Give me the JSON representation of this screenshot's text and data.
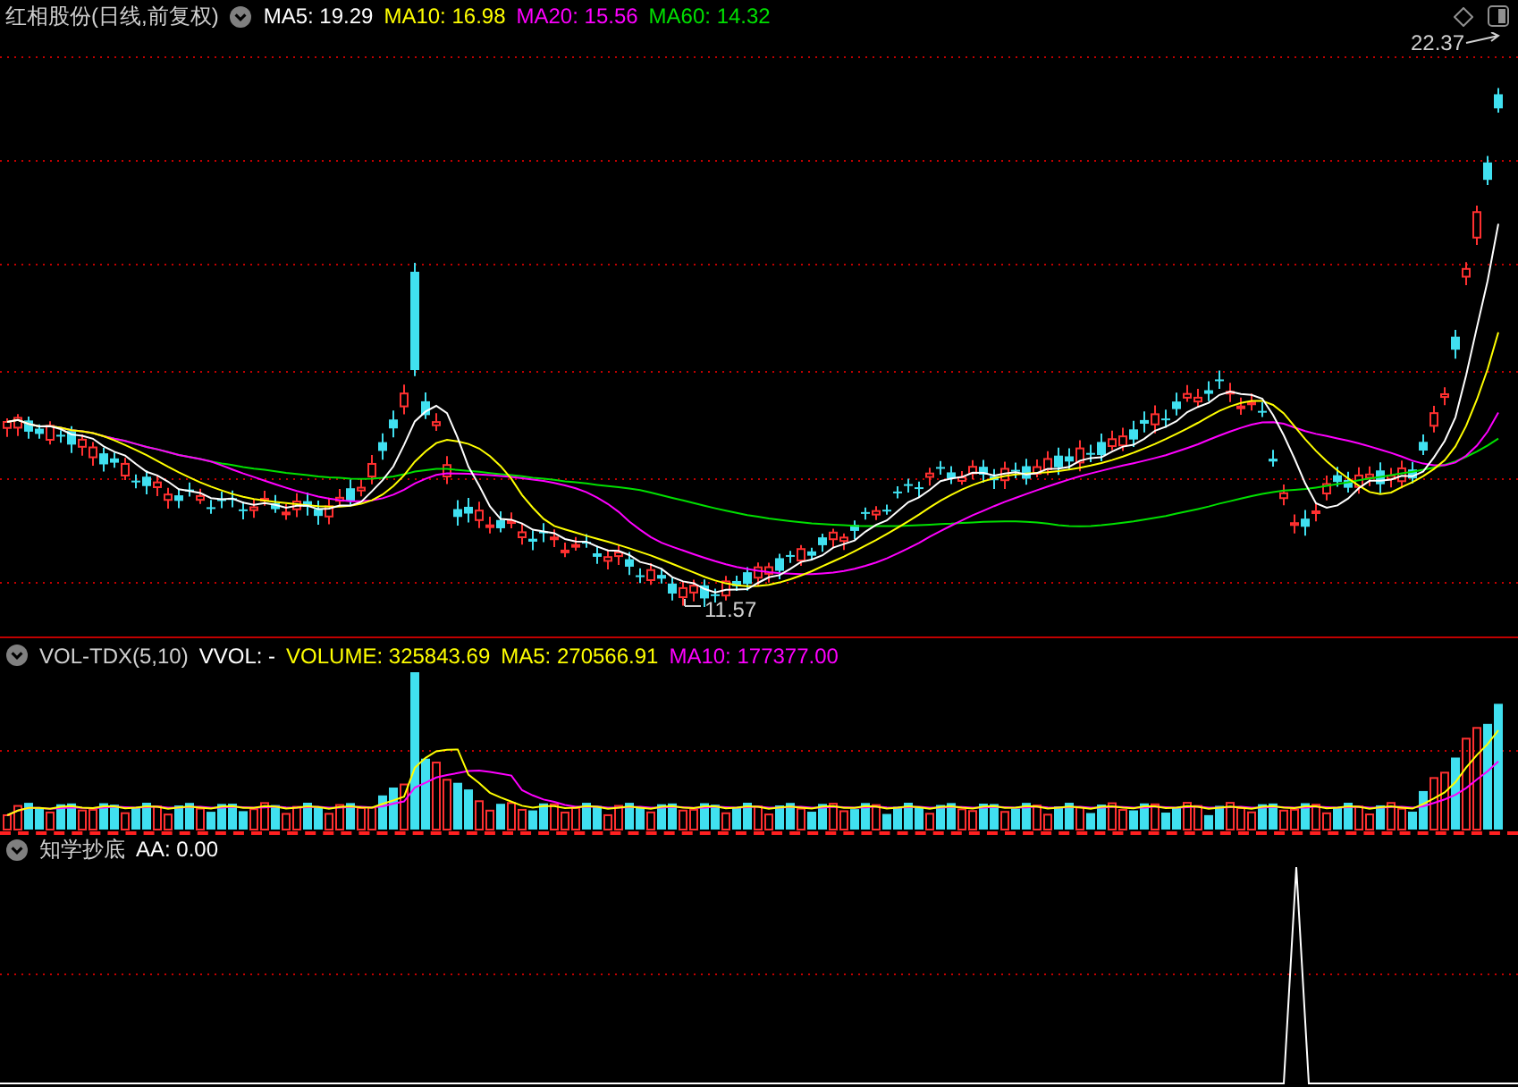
{
  "title": "红相股份(日线,前复权)",
  "ma_legend": [
    {
      "label": "MA5: 19.29",
      "color": "#ffffff"
    },
    {
      "label": "MA10: 16.98",
      "color": "#ffff00"
    },
    {
      "label": "MA20: 15.56",
      "color": "#ff00ff"
    },
    {
      "label": "MA60: 14.32",
      "color": "#00e000"
    }
  ],
  "price_chart": {
    "high_label": "22.37",
    "low_label": "11.57"
  },
  "volume_panel": {
    "title": "VOL-TDX(5,10)",
    "legend": [
      {
        "label": "VVOL: -",
        "color": "#ffffff"
      },
      {
        "label": "VOLUME: 325843.69",
        "color": "#ffff00"
      },
      {
        "label": "MA5: 270566.91",
        "color": "#ffff00"
      },
      {
        "label": "MA10: 177377.00",
        "color": "#ff00ff"
      }
    ]
  },
  "indicator_panel": {
    "title": "知学抄底",
    "legend": [
      {
        "label": "AA: 0.00",
        "color": "#ffffff"
      }
    ]
  }
}
